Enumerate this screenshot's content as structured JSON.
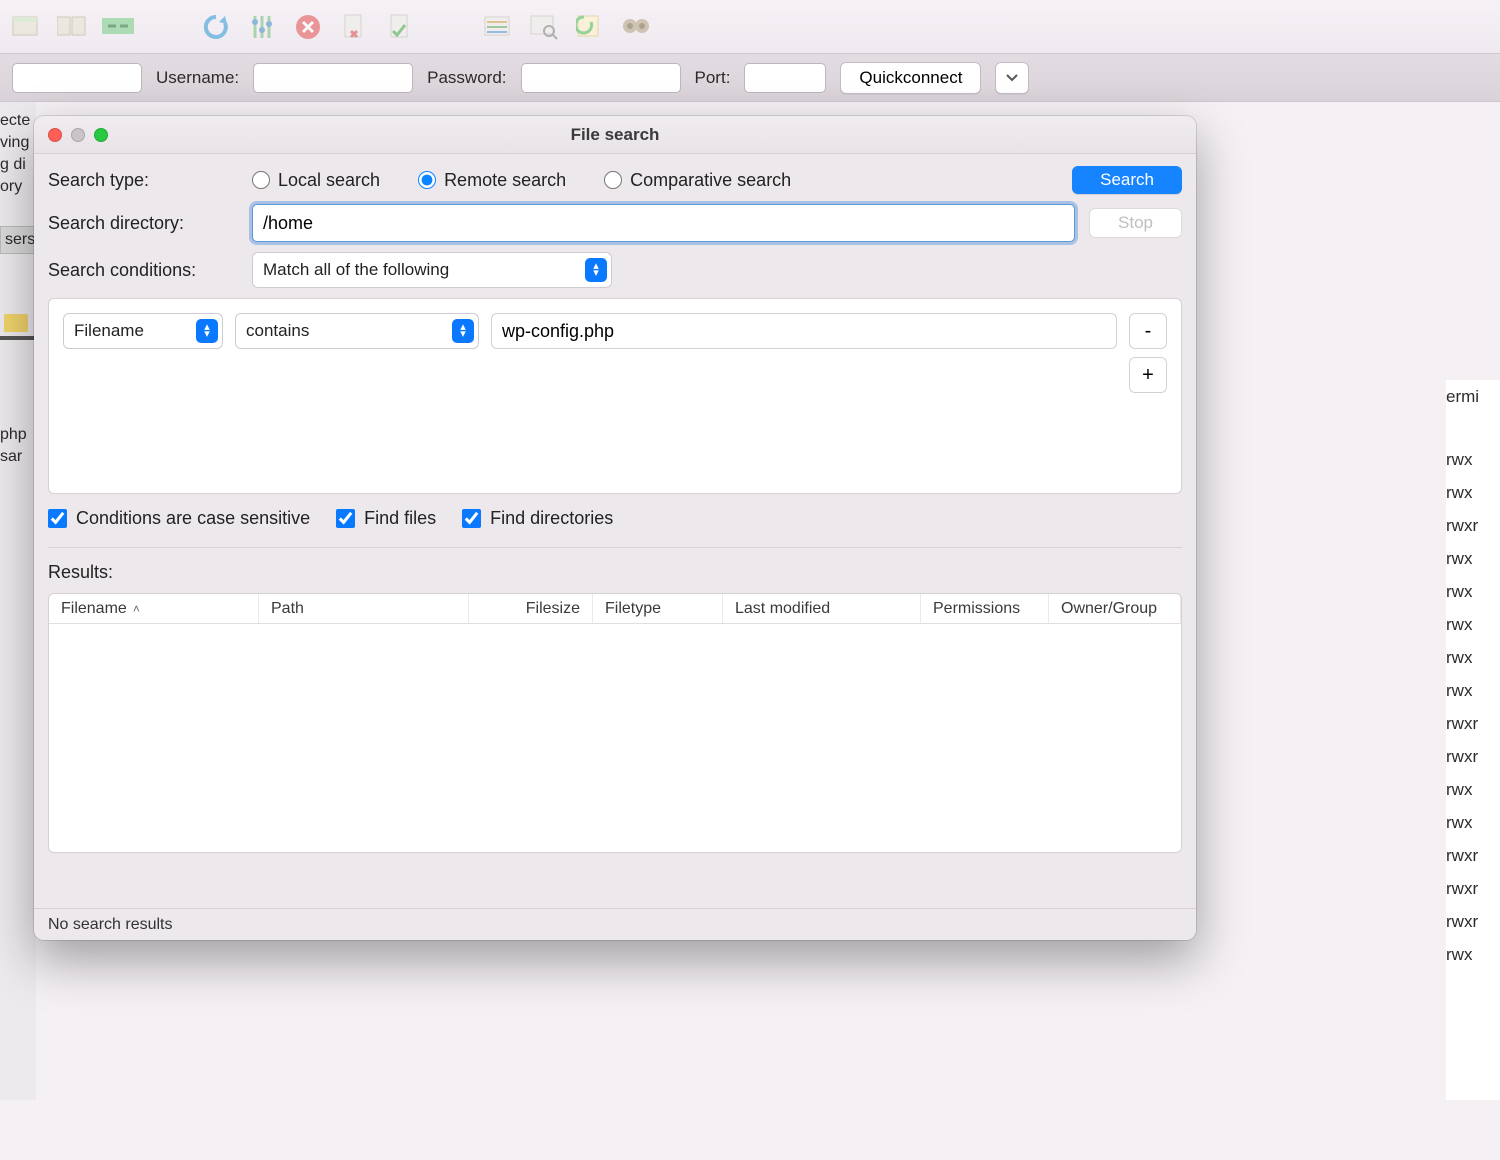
{
  "toolbar": {
    "icons": [
      "sitemanager-icon",
      "toggle-panes-icon",
      "sync-icon",
      "refresh-icon",
      "settings-icon",
      "cancel-icon",
      "disconnect-icon",
      "reconnect-icon",
      "view-list-icon",
      "search-log-icon",
      "compare-icon",
      "find-icon"
    ]
  },
  "connbar": {
    "username_label": "Username:",
    "password_label": "Password:",
    "port_label": "Port:",
    "username": "",
    "password": "",
    "port": "",
    "quickconnect": "Quickconnect"
  },
  "bg_left": [
    "ecte",
    "ving",
    "g di",
    "ory"
  ],
  "bg_lower_left": [
    "sers"
  ],
  "bg_left_tail": [
    "php",
    "sar"
  ],
  "bg_right_top": "ermi",
  "bg_right_perms": [
    "rwx",
    "rwx",
    "rwxr",
    "rwx",
    "rwx",
    "rwx",
    "rwx",
    "rwx",
    "rwxr",
    "rwxr",
    "rwx",
    "rwx",
    "rwxr",
    "rwxr",
    "rwxr",
    "rwx"
  ],
  "modal": {
    "title": "File search",
    "search_type_label": "Search type:",
    "search_directory_label": "Search directory:",
    "search_conditions_label": "Search conditions:",
    "radios": {
      "local": "Local search",
      "remote": "Remote search",
      "comparative": "Comparative search"
    },
    "search_btn": "Search",
    "stop_btn": "Stop",
    "directory": "/home",
    "match_mode": "Match all of the following",
    "condition": {
      "field": "Filename",
      "op": "contains",
      "value": "wp-config.php",
      "minus": "-",
      "plus": "+"
    },
    "checks": {
      "case": "Conditions are case sensitive",
      "files": "Find files",
      "dirs": "Find directories"
    },
    "results_label": "Results:",
    "columns": {
      "filename": "Filename",
      "path": "Path",
      "filesize": "Filesize",
      "filetype": "Filetype",
      "last_modified": "Last modified",
      "permissions": "Permissions",
      "owner_group": "Owner/Group"
    },
    "status": "No search results"
  }
}
